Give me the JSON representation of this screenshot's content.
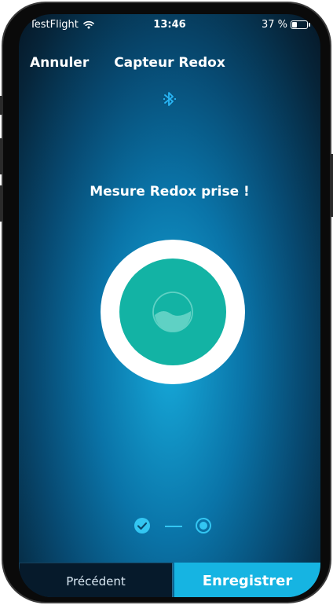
{
  "status_bar": {
    "carrier": "TestFlight",
    "time": "13:46",
    "battery_label": "37 %",
    "battery_level": 0.37
  },
  "nav": {
    "cancel_label": "Annuler",
    "title": "Capteur Redox"
  },
  "icons": {
    "bluetooth": "bluetooth-icon",
    "wifi": "wifi-icon",
    "water": "water-wave-icon",
    "check": "check-circle-icon",
    "radio": "radio-selected-icon"
  },
  "main": {
    "headline": "Mesure Redox prise !"
  },
  "steps": {
    "total": 2,
    "completed": 1,
    "current": 2
  },
  "footer": {
    "previous_label": "Précédent",
    "save_label": "Enregistrer"
  },
  "colors": {
    "accent": "#16b4e2",
    "disc": "#13b3a4",
    "bluetooth": "#29b6f6"
  }
}
